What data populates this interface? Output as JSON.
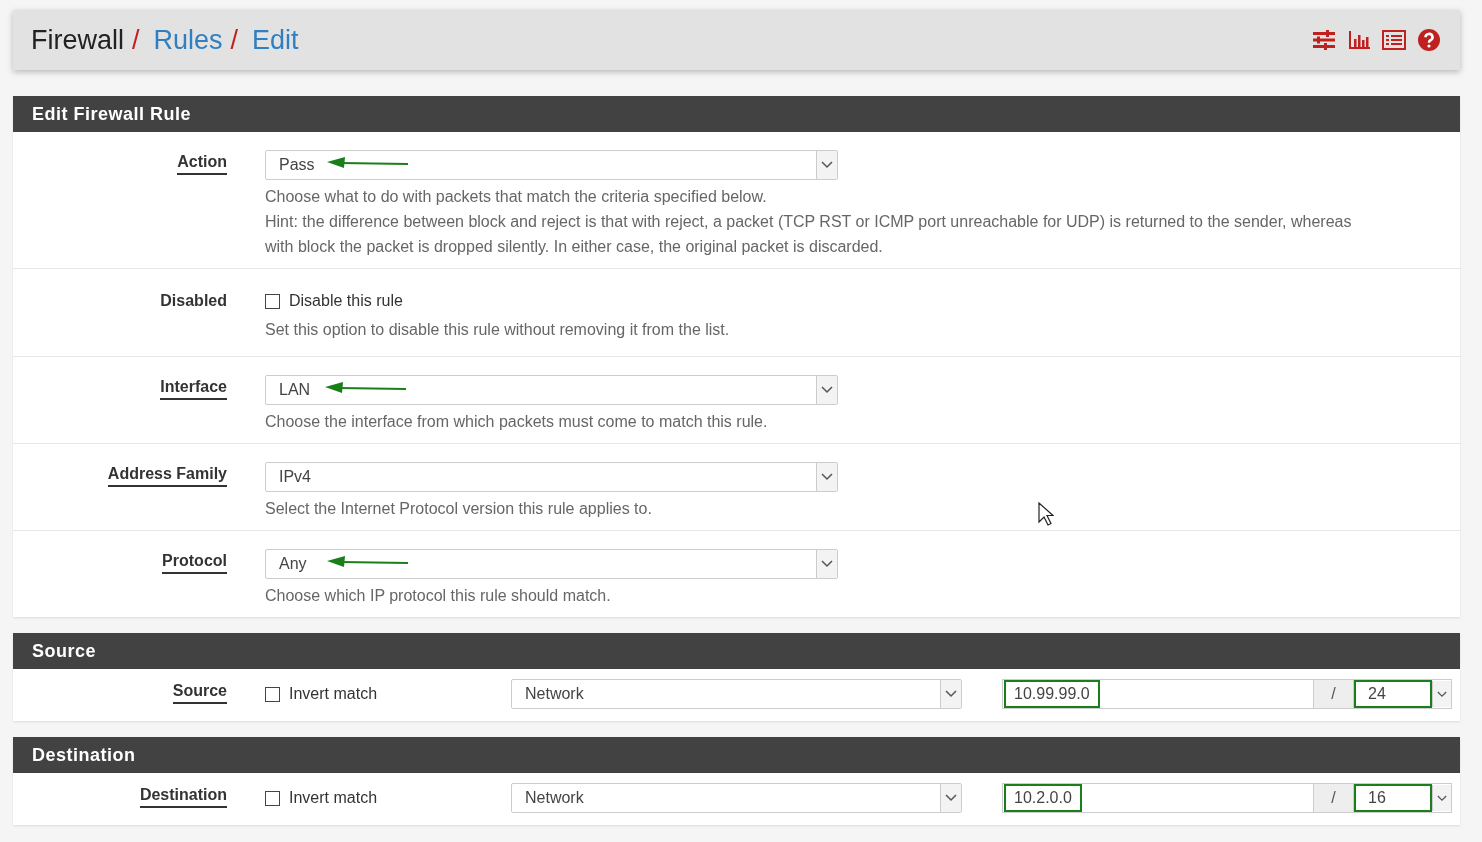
{
  "breadcrumb": [
    {
      "label": "Firewall",
      "link": false,
      "separator": "/"
    },
    {
      "label": "Rules",
      "link": true,
      "separator": "/"
    },
    {
      "label": "Edit",
      "link": true
    }
  ],
  "panels": [
    {
      "title": "Edit Firewall Rule",
      "rows": [
        {
          "kind": "select",
          "label": "Action",
          "linked": true,
          "value": "Pass",
          "annotated": true,
          "help": [
            "Choose what to do with packets that match the criteria specified below.",
            "Hint: the difference between block and reject is that with reject, a packet (TCP RST or ICMP port unreachable for UDP) is returned to the sender, whereas with block the packet is dropped silently. In either case, the original packet is discarded."
          ]
        },
        {
          "kind": "checkbox",
          "label": "Disabled",
          "linked": false,
          "checked": false,
          "option": "Disable this rule",
          "help": [
            "Set this option to disable this rule without removing it from the list."
          ]
        },
        {
          "kind": "select",
          "label": "Interface",
          "linked": true,
          "value": "LAN",
          "annotated": true,
          "help": [
            "Choose the interface from which packets must come to match this rule."
          ]
        },
        {
          "kind": "select",
          "label": "Address Family",
          "linked": true,
          "value": "IPv4",
          "annotated": false,
          "help": [
            "Select the Internet Protocol version this rule applies to."
          ]
        },
        {
          "kind": "select",
          "label": "Protocol",
          "linked": true,
          "value": "Any",
          "annotated": true,
          "help": [
            "Choose which IP protocol this rule should match."
          ]
        }
      ]
    },
    {
      "title": "Source",
      "rows": [
        {
          "kind": "address",
          "label": "Source",
          "linked": true,
          "checked": false,
          "option": "Invert match",
          "type": "Network",
          "address": "10.99.99.0",
          "separator": "/",
          "mask": "24",
          "highlighted": true
        }
      ]
    },
    {
      "title": "Destination",
      "rows": [
        {
          "kind": "address",
          "label": "Destination",
          "linked": true,
          "checked": false,
          "option": "Invert match",
          "type": "Network",
          "address": "10.2.0.0",
          "separator": "/",
          "mask": "16",
          "highlighted": true
        }
      ]
    }
  ]
}
